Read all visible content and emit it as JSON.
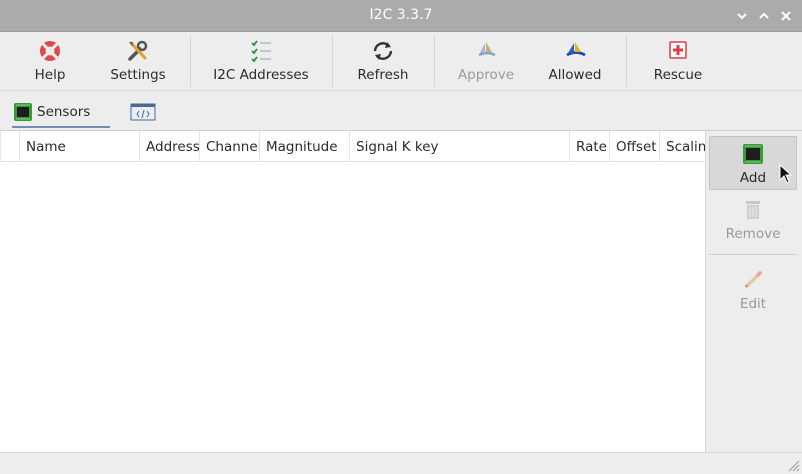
{
  "window": {
    "title": "I2C 3.3.7"
  },
  "window_controls": [
    "chevron-down-icon",
    "chevron-up-icon",
    "close-icon"
  ],
  "toolbar": {
    "help": "Help",
    "settings": "Settings",
    "i2c_addresses": "I2C Addresses",
    "refresh": "Refresh",
    "approve": "Approve",
    "allowed": "Allowed",
    "rescue": "Rescue"
  },
  "tabs": {
    "sensors": "Sensors"
  },
  "table": {
    "columns": [
      "Name",
      "Address",
      "Channel",
      "Magnitude",
      "Signal K key",
      "Rate",
      "Offset",
      "Scalin"
    ],
    "rows": []
  },
  "side_panel": {
    "add": "Add",
    "remove": "Remove",
    "edit": "Edit"
  },
  "colors": {
    "titlebar": "#a9abad",
    "accent_tab": "#6d8fb5",
    "rescue_red": "#e03c48",
    "chip_green": "#3a9a3a"
  }
}
